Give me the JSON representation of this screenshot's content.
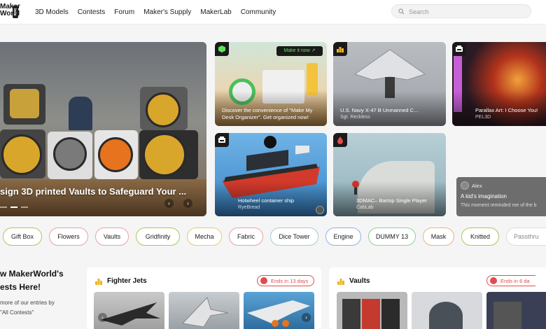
{
  "header": {
    "logo_top": "Maker",
    "logo_bottom": "World",
    "logo_badge": "beta",
    "nav": [
      "3D Models",
      "Contests",
      "Forum",
      "Maker's Supply",
      "MakerLab",
      "Community"
    ],
    "search_placeholder": "Search"
  },
  "hero": {
    "title": "sign 3D printed Vaults to Safeguard Your ...",
    "prev_icon": "‹",
    "next_icon": "›"
  },
  "cards": [
    {
      "title": "Discover the convenience of \"Make My",
      "title2": "Desk Organizer\". Get organized now!",
      "button": "Make it now",
      "badge_icon": "cube-icon"
    },
    {
      "title": "U.S. Navy X-47 B Unmanned C...",
      "author": "Sgt. Reckless",
      "badge_icon": "podium-icon"
    },
    {
      "title": "Parallax Art: I Choose You!",
      "author": "PEL3D",
      "badge_icon": "printer-icon"
    },
    {
      "title": "Hotwheel container ship",
      "author": "RyeBread",
      "badge_icon": "printer-icon"
    },
    {
      "title": "3DMAC– Bartop Single Player",
      "author": "CabLab",
      "badge_icon": "drop-icon"
    }
  ],
  "comment": {
    "user": "Alex",
    "heading": "A kid's imagination",
    "body": "This moment reminded me of the b"
  },
  "tags": [
    {
      "label": "Gift Box",
      "color": "#a8c95b"
    },
    {
      "label": "Flowers",
      "color": "#e7a4a4"
    },
    {
      "label": "Vaults",
      "color": "#e7a4a4"
    },
    {
      "label": "Gridfinity",
      "color": "#a8c95b"
    },
    {
      "label": "Mecha",
      "color": "#e2c977"
    },
    {
      "label": "Fabric",
      "color": "#e7a4a4"
    },
    {
      "label": "Dice Tower",
      "color": "#a8c9d8"
    },
    {
      "label": "Engine",
      "color": "#8fb0e0"
    },
    {
      "label": "DUMMY 13",
      "color": "#8fd19a"
    },
    {
      "label": "Mask",
      "color": "#e7b48a"
    },
    {
      "label": "Knitted",
      "color": "#a8c95b"
    },
    {
      "label": "Passthru",
      "color": "#dddddd"
    }
  ],
  "contest_intro": {
    "line1": "w MakerWorld's",
    "line2": "ests Here!",
    "line3": "more of our entries by",
    "line4": "\"All Contests\""
  },
  "contests": [
    {
      "title": "Fighter Jets",
      "ends": "Ends in 13 days"
    },
    {
      "title": "Vaults",
      "ends": "Ends in 6 da"
    }
  ],
  "colors": {
    "accent_green": "#5de35d",
    "deadline_red": "#e24c4c",
    "trophy_gold": "#f0b323"
  }
}
